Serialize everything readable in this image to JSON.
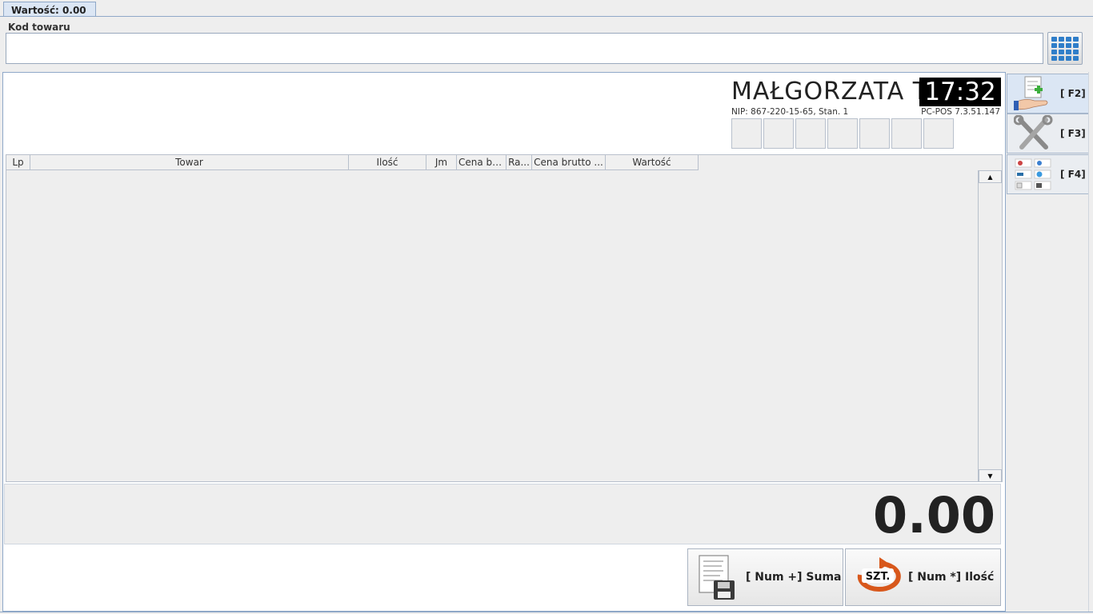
{
  "tab": {
    "label": "Wartość: 0.00"
  },
  "kod": {
    "label": "Kod towaru",
    "value": "",
    "keypad_icon": "keypad-icon"
  },
  "header": {
    "name": "MAŁGORZATA T",
    "clock": "17:32",
    "nip": "NIP: 867-220-15-65, Stan. 1",
    "version": "PC-POS 7.3.51.147"
  },
  "table": {
    "columns": [
      "Lp",
      "Towar",
      "Ilość",
      "Jm",
      "Cena br...",
      "Ra...",
      "Cena brutto ...",
      "Wartość"
    ],
    "rows": []
  },
  "total": {
    "value": "0.00"
  },
  "buttons": {
    "suma": {
      "label": "[ Num +] Suma",
      "icon": "document-save-icon"
    },
    "ilosc": {
      "label": "[ Num *] Ilość",
      "icon": "szt-quantity-icon",
      "icon_text": "SZT."
    }
  },
  "side": [
    {
      "key": "[ F2]",
      "icon": "add-document-hand-icon",
      "active": true
    },
    {
      "key": "[ F3]",
      "icon": "tools-icon",
      "active": false
    },
    {
      "key": "[ F4]",
      "icon": "functions-grid-icon",
      "active": false
    }
  ],
  "colors": {
    "accent": "#8fa8c8",
    "clock_bg": "#000000",
    "szt_orange": "#d8581c"
  }
}
